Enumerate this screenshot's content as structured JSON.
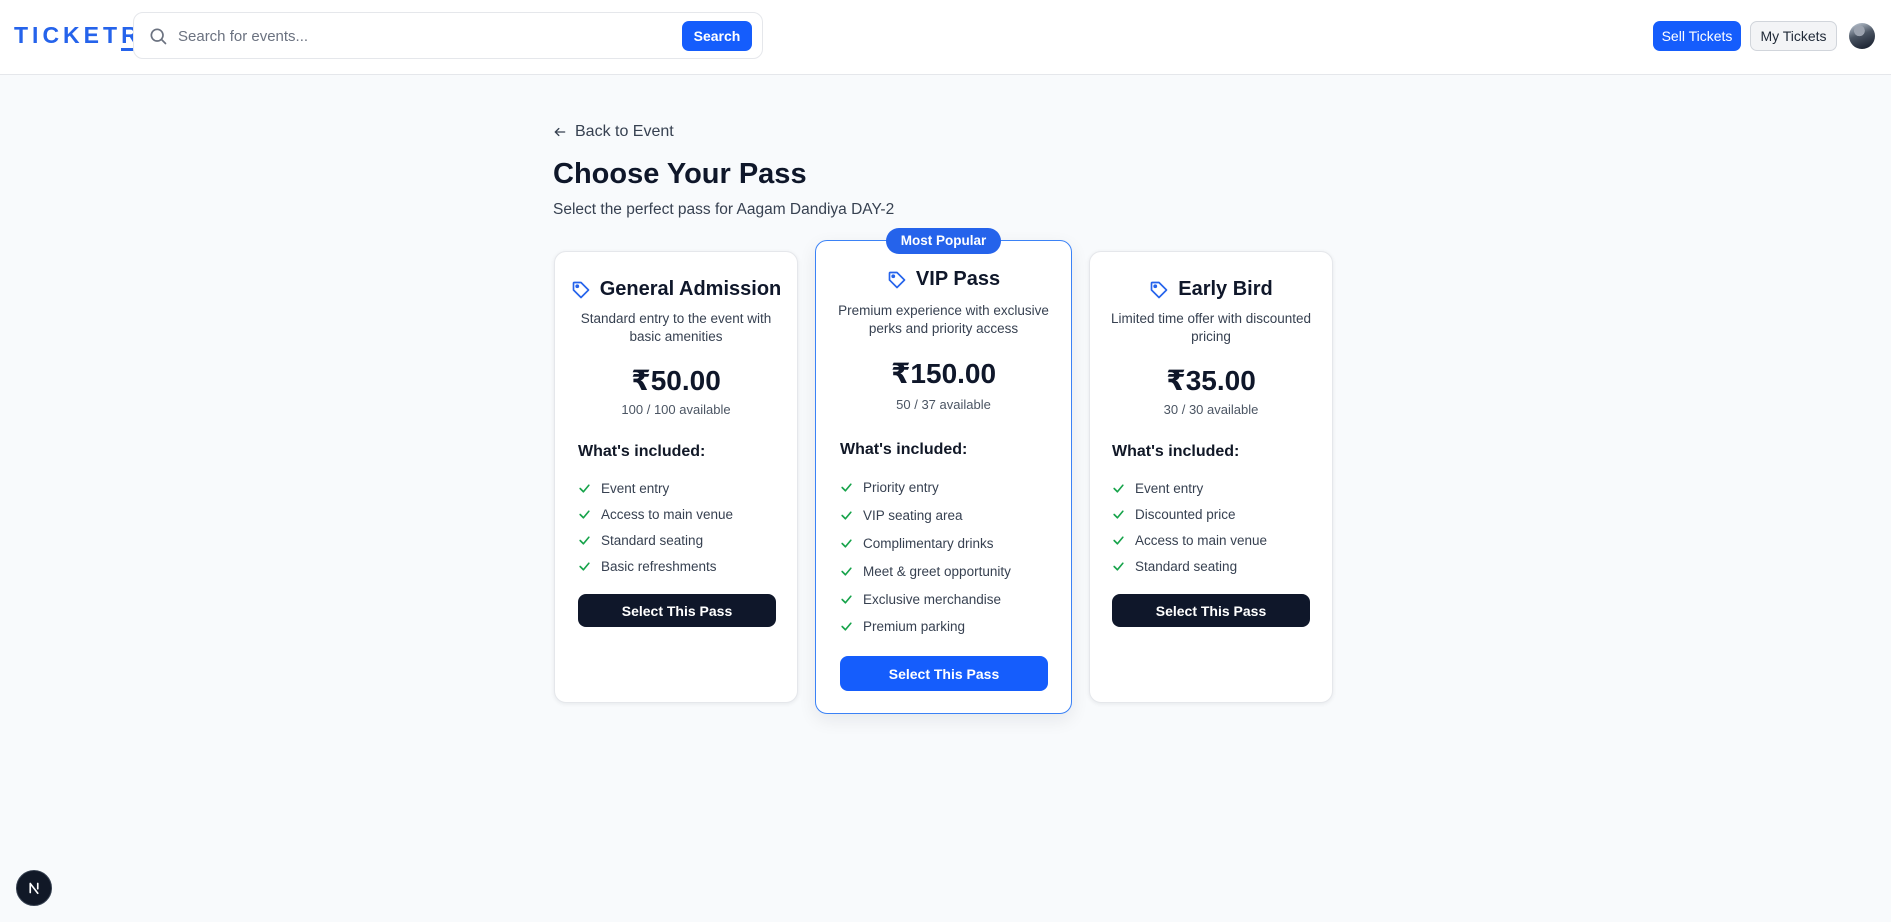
{
  "header": {
    "logo_text": "TICKET",
    "logo_last": "R",
    "search": {
      "placeholder": "Search for events...",
      "button": "Search"
    },
    "sell_label": "Sell Tickets",
    "my_tickets_label": "My Tickets"
  },
  "page": {
    "back_label": "Back to Event",
    "title": "Choose Your Pass",
    "subtitle": "Select the perfect pass for Aagam Dandiya DAY-2"
  },
  "passes": [
    {
      "name": "General Admission",
      "description": "Standard entry to the event with basic amenities",
      "price": "₹50.00",
      "availability": "100 / 100 available",
      "included_title": "What's included:",
      "features": [
        "Event entry",
        "Access to main venue",
        "Standard seating",
        "Basic refreshments"
      ],
      "button": "Select This Pass"
    },
    {
      "name": "VIP Pass",
      "badge": "Most Popular",
      "description": "Premium experience with exclusive perks and priority access",
      "price": "₹150.00",
      "availability": "50 / 37 available",
      "included_title": "What's included:",
      "features": [
        "Priority entry",
        "VIP seating area",
        "Complimentary drinks",
        "Meet & greet opportunity",
        "Exclusive merchandise",
        "Premium parking"
      ],
      "button": "Select This Pass"
    },
    {
      "name": "Early Bird",
      "description": "Limited time offer with discounted pricing",
      "price": "₹35.00",
      "availability": "30 / 30 available",
      "included_title": "What's included:",
      "features": [
        "Event entry",
        "Discounted price",
        "Access to main venue",
        "Standard seating"
      ],
      "button": "Select This Pass"
    }
  ],
  "colors": {
    "brand": "#2563eb",
    "primary_button": "#155dfc",
    "dark_button": "#0f172a",
    "check": "#16a34a",
    "background": "#f8fafc"
  },
  "icons": [
    "search-icon",
    "arrow-left-icon",
    "tag-icon",
    "check-icon",
    "avatar",
    "next-logo-icon"
  ]
}
